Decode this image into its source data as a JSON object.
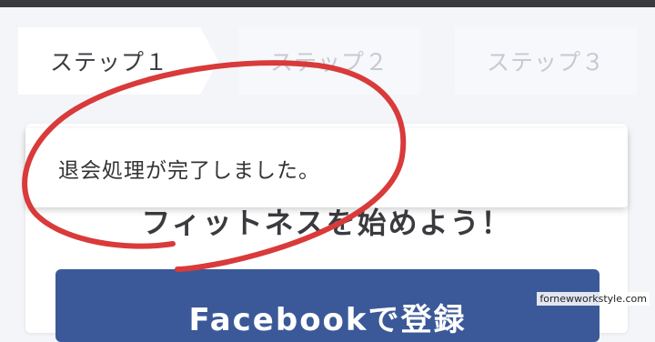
{
  "steps": [
    {
      "label": "ステップ１",
      "state": "active"
    },
    {
      "label": "ステップ２",
      "state": "inactive"
    },
    {
      "label": "ステップ３",
      "state": "inactive"
    }
  ],
  "card": {
    "headline": "フィットネスを始めよう！",
    "facebook_button_label": "Facebookで登録"
  },
  "toast": {
    "message": "退会処理が完了しました。"
  },
  "annotation": {
    "color": "#d93a3a"
  },
  "watermark": "fornewworkstyle.com",
  "colors": {
    "top_bar": "#3a3a3f",
    "facebook_blue": "#3b5998",
    "background": "#f4f5f9"
  }
}
